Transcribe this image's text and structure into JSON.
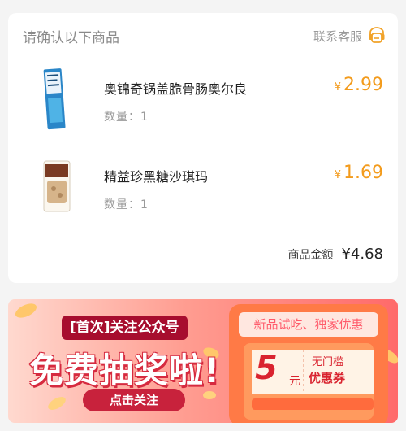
{
  "order": {
    "title": "请确认以下商品",
    "service_label": "联系客服",
    "items": [
      {
        "name": "奥锦奇锅盖脆骨肠奥尔良",
        "qty_label": "数量：1",
        "currency": "¥",
        "price": "2.99"
      },
      {
        "name": "精益珍黑糖沙琪玛",
        "qty_label": "数量：1",
        "currency": "¥",
        "price": "1.69"
      }
    ],
    "total_label": "商品金额",
    "total_value": "¥4.68"
  },
  "banner": {
    "first_time": "[首次]关注公众号",
    "headline": "免费抽奖啦!",
    "cta": "点击关注",
    "tag": "新品试吃、独家优惠",
    "coupon_value": "5",
    "coupon_unit": "元",
    "coupon_threshold": "无门槛",
    "coupon_label": "优惠券"
  },
  "colors": {
    "price": "#f39b1c",
    "banner_accent": "#d9232f"
  }
}
